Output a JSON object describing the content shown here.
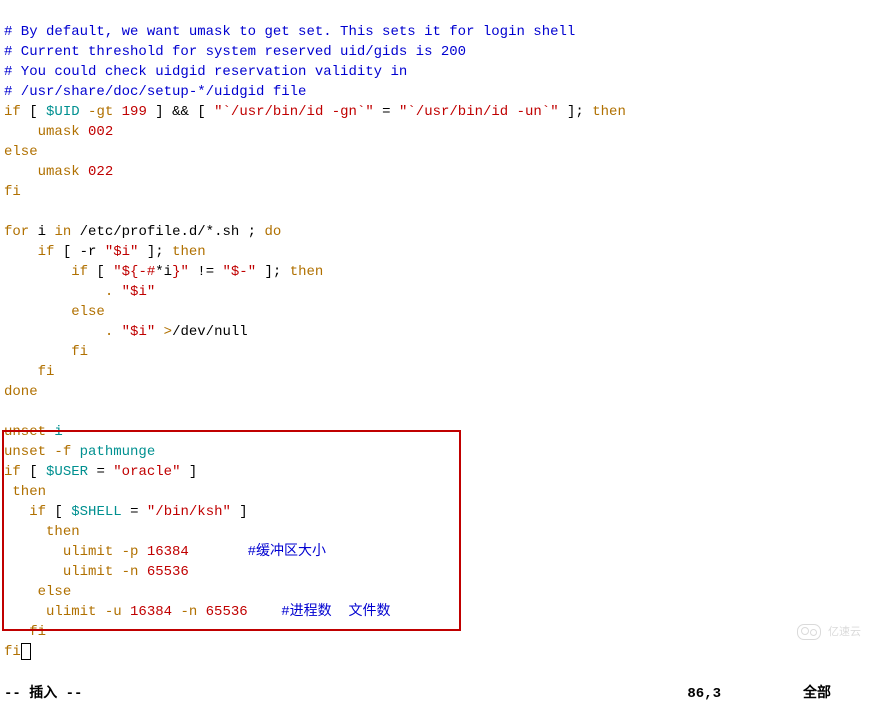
{
  "code": {
    "l1": "# By default, we want umask to get set. This sets it for login shell",
    "l2": "# Current threshold for system reserved uid/gids is 200",
    "l3": "# You could check uidgid reservation validity in",
    "l4": "# /usr/share/doc/setup-*/uidgid file",
    "l5": {
      "if": "if",
      "br1": " [ ",
      "var": "$UID",
      "op": " -gt ",
      "num": "199",
      "br2": " ] ",
      "and": "&&",
      "br3": " [ ",
      "s1": "\"`/usr/bin/id -gn`\"",
      "eq": " = ",
      "s2": "\"`/usr/bin/id -un`\"",
      "br4": " ]; ",
      "then": "then"
    },
    "l6": {
      "umask": "umask",
      "sp": " ",
      "n": "002"
    },
    "l7": "else",
    "l8": {
      "umask": "umask",
      "sp": " ",
      "n": "022"
    },
    "l9": "fi",
    "l11": {
      "for": "for",
      "i": " i ",
      "in": "in",
      "path": " /etc/profile.d/*.sh ; ",
      "do": "do"
    },
    "l12": {
      "if": "if",
      "br": " [ -r ",
      "s": "\"$i\"",
      "br2": " ]; ",
      "then": "then"
    },
    "l13": {
      "if": "if",
      "br": " [ ",
      "s1": "\"${-#",
      "star": "*i",
      "s1b": "}\"",
      "ne": " != ",
      "s2": "\"$-\"",
      "br2": " ]; ",
      "then": "then"
    },
    "l14": {
      "dot": ". ",
      "s": "\"$i\""
    },
    "l15": "else",
    "l16": {
      "dot": ". ",
      "s": "\"$i\"",
      "gt": " >",
      "path": "/dev/null"
    },
    "l17": "fi",
    "l18": "fi",
    "l19": "done",
    "l21": {
      "unset": "unset",
      "i": " i"
    },
    "l22": {
      "unset": "unset",
      "f": " -f ",
      "fn": "pathmunge"
    },
    "l23": {
      "if": "if",
      "br": " [ ",
      "var": "$USER",
      "eq": " = ",
      "s": "\"oracle\"",
      "br2": " ]"
    },
    "l24": "then",
    "l25": {
      "if": "if",
      "br": " [ ",
      "var": "$SHELL",
      "eq": " = ",
      "s": "\"/bin/ksh\"",
      "br2": " ]"
    },
    "l26": "then",
    "l27": {
      "cmd": "ulimit -p ",
      "n": "16384",
      "sp": "       ",
      "c": "#缓冲区大小"
    },
    "l28": {
      "cmd": "ulimit -n ",
      "n": "65536"
    },
    "l29": "else",
    "l30": {
      "cmd": "ulimit -u ",
      "n1": "16384",
      "op": " -n ",
      "n2": "65536",
      "sp": "    ",
      "c": "#进程数  文件数"
    },
    "l31": "fi",
    "l32": "fi"
  },
  "status": {
    "mode": "-- 插入 --",
    "pos": "86,3",
    "view": "全部"
  },
  "watermark": "亿速云"
}
